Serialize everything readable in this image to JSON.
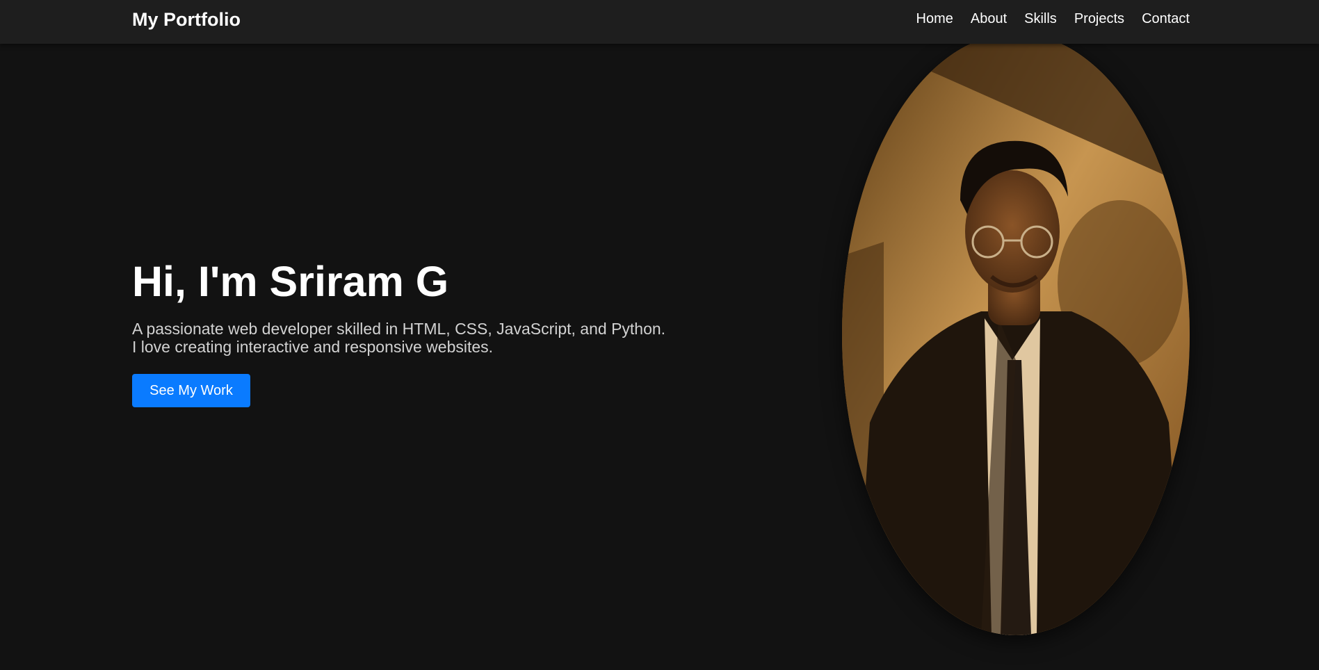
{
  "nav": {
    "brand": "My Portfolio",
    "links": [
      "Home",
      "About",
      "Skills",
      "Projects",
      "Contact"
    ]
  },
  "hero": {
    "title": "Hi, I'm Sriram G",
    "description_lines": [
      "A passionate web developer skilled in HTML, CSS, JavaScript, and Python.",
      "I love creating interactive and responsive websites."
    ],
    "cta_label": "See My Work"
  },
  "colors": {
    "background": "#121212",
    "navbar": "#1e1e1e",
    "accent": "#0a7bff",
    "text": "#ffffff",
    "muted_text": "#d2d2d2"
  }
}
